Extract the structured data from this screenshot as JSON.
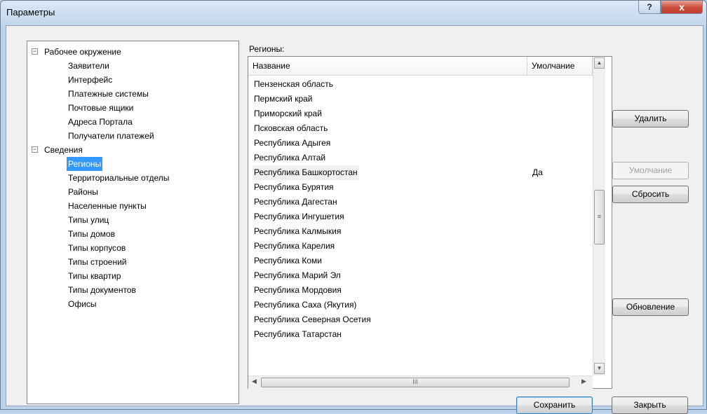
{
  "window": {
    "title": "Параметры",
    "help": "?",
    "close": "x"
  },
  "tree": {
    "groups": [
      {
        "label": "Рабочее окружение",
        "expander": "−",
        "children": [
          "Заявители",
          "Интерфейс",
          "Платежные системы",
          "Почтовые ящики",
          "Адреса Портала",
          "Получатели платежей"
        ]
      },
      {
        "label": "Сведения",
        "expander": "−",
        "children": [
          "Регионы",
          "Территориальные отделы",
          "Районы",
          "Населенные пункты",
          "Типы улиц",
          "Типы домов",
          "Типы корпусов",
          "Типы строений",
          "Типы квартир",
          "Типы документов",
          "Офисы"
        ]
      }
    ],
    "selected": "Регионы"
  },
  "list": {
    "caption": "Регионы:",
    "columns": {
      "name": "Название",
      "default": "Умолчание"
    },
    "rows": [
      {
        "name": "Пензенская область",
        "default": ""
      },
      {
        "name": "Пермский край",
        "default": ""
      },
      {
        "name": "Приморский край",
        "default": ""
      },
      {
        "name": "Псковская область",
        "default": ""
      },
      {
        "name": "Республика Адыгея",
        "default": ""
      },
      {
        "name": "Республика Алтай",
        "default": ""
      },
      {
        "name": "Республика Башкортостан",
        "default": "Да"
      },
      {
        "name": "Республика Бурятия",
        "default": ""
      },
      {
        "name": "Республика Дагестан",
        "default": ""
      },
      {
        "name": "Республика Ингушетия",
        "default": ""
      },
      {
        "name": "Республика Калмыкия",
        "default": ""
      },
      {
        "name": "Республика Карелия",
        "default": ""
      },
      {
        "name": "Республика Коми",
        "default": ""
      },
      {
        "name": "Республика Марий Эл",
        "default": ""
      },
      {
        "name": "Республика Мордовия",
        "default": ""
      },
      {
        "name": "Республика Саха (Якутия)",
        "default": ""
      },
      {
        "name": "Республика Северная Осетия",
        "default": ""
      },
      {
        "name": "Республика Татарстан",
        "default": ""
      }
    ],
    "highlighted_row": 6,
    "scrollbar": {
      "up": "▲",
      "down": "▼",
      "grip": "≡",
      "left": "◀",
      "right": "▶",
      "hgrip": "III"
    }
  },
  "buttons": {
    "delete": "Удалить",
    "default": "Умолчание",
    "reset": "Сбросить",
    "refresh": "Обновление",
    "save": "Сохранить",
    "close": "Закрыть"
  }
}
